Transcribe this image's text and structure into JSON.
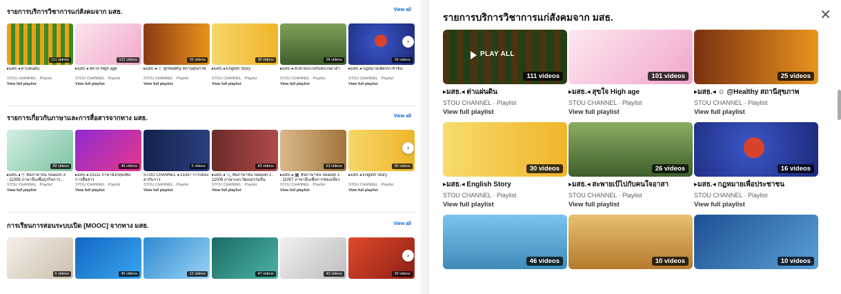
{
  "left": {
    "shelves": [
      {
        "title": "รายการบริการวิชาการแก่สังคมจาก มสธ.",
        "view_all": "View all",
        "cards": [
          {
            "title": "▸มสธ.◂ ต่าแผ่นดิน",
            "badge": "111 videos",
            "meta": "STOU CHANNEL · Playlist",
            "link": "View full playlist",
            "thumb": "#5a8c2a"
          },
          {
            "title": "▸มสธ.◂ สุขใจ High age",
            "badge": "101 videos",
            "meta": "STOU CHANNEL · Playlist",
            "link": "View full playlist",
            "thumb": "#f2b3d3"
          },
          {
            "title": "▸มสธ.◂ ☺ @Healthy สถานีสุขภาพ",
            "badge": "25 videos",
            "meta": "STOU CHANNEL · Playlist",
            "link": "View full playlist",
            "thumb": "#e58b1e"
          },
          {
            "title": "▸มสธ.◂ English Story",
            "badge": "30 videos",
            "meta": "STOU CHANNEL · Playlist",
            "link": "View full playlist",
            "thumb": "#f1c63a"
          },
          {
            "title": "▸มสธ.◂ สะพายเป้ไปกับคนใจอาสา",
            "badge": "26 videos",
            "meta": "STOU CHANNEL · Playlist",
            "link": "View full playlist",
            "thumb": "#6a8d4c"
          },
          {
            "title": "▸มสธ.◂ กฎหมายเพื่อประชาชน",
            "badge": "16 videos",
            "meta": "STOU CHANNEL · Playlist",
            "link": "View full playlist",
            "thumb": "#2b3e9b"
          }
        ]
      },
      {
        "title": "รายการเกี่ยวกับภาษาและการสื่อสารจากทาง มสธ.",
        "view_all": "View all",
        "cards": [
          {
            "title": "▸มสธ.◂ ⓔ สื่อภาษาจีน Season 3\n: 11008 ภาษาจีนเพื่อธุรกิจการ...",
            "badge": "80 videos",
            "meta": "STOU CHANNEL · Playlist",
            "link": "View full playlist",
            "thumb": "#7cc3a3"
          },
          {
            "title": "▸มสธ.◂ 10111 ภาษาอังกฤษเพื่อ\nการสื่อสาร",
            "badge": "46 videos",
            "meta": "STOU CHANNEL · Playlist",
            "link": "View full playlist",
            "thumb": "#e8388d"
          },
          {
            "title": "STOU CHANNEL ◂ 15337 การเมืองสากับการ\nพัฒนา",
            "badge": "5 videos",
            "meta": "STOU CHANNEL · Playlist",
            "link": "View full playlist",
            "thumb": "#1b2b5e"
          },
          {
            "title": "▸มสธ.◂ 🔍 สื่อภาษาจีน Season 2 :\n11009 ภาษาและวัฒนธรรมจีน",
            "badge": "83 videos",
            "meta": "STOU CHANNEL · Playlist",
            "link": "View full playlist",
            "thumb": "#b04a4a"
          },
          {
            "title": "▸มสธ.◂ 🏛 สื่อภาษาจีน Season 1\n: 11007 ภาษาจีนเพื่อการท่องเที่ยว",
            "badge": "63 videos",
            "meta": "STOU CHANNEL · Playlist",
            "link": "View full playlist",
            "thumb": "#c49a5a"
          },
          {
            "title": "▸มสธ.◂ English Story",
            "badge": "30 videos",
            "meta": "STOU CHANNEL · Playlist",
            "link": "View full playlist",
            "thumb": "#f1c63a"
          }
        ]
      },
      {
        "title": "การเรียนการสอนระบบเปิด [MOOC] จากทาง มสธ.",
        "view_all": "View all",
        "cards": [
          {
            "badge": "6 videos",
            "thumb": "#e9e4dc"
          },
          {
            "badge": "45 videos",
            "thumb": "#1e7fd8"
          },
          {
            "badge": "12 videos",
            "thumb": "#59b1e6"
          },
          {
            "badge": "47 videos",
            "thumb": "#2e8f86"
          },
          {
            "badge": "40 videos",
            "thumb": "#d7d7d7"
          },
          {
            "badge": "39 videos",
            "thumb": "#c0392b"
          }
        ]
      }
    ]
  },
  "modal": {
    "title": "รายการบริการวิชาการแก่สังคมจาก มสธ.",
    "play_all": "PLAY ALL",
    "cards": [
      {
        "title": "▸มสธ.◂ ต่าแผ่นดิน",
        "badge": "111 videos",
        "meta": "STOU CHANNEL · Playlist",
        "link": "View full playlist",
        "thumb": "#3e5a2a"
      },
      {
        "title": "▸มสธ.◂ สุขใจ High age",
        "badge": "101 videos",
        "meta": "STOU CHANNEL · Playlist",
        "link": "View full playlist",
        "thumb": "#f2b3d3"
      },
      {
        "title": "▸มสธ.◂ ☺ @Healthy สถานีสุขภาพ",
        "badge": "25 videos",
        "meta": "STOU CHANNEL · Playlist",
        "link": "View full playlist",
        "thumb": "#e58b1e"
      },
      {
        "title": "▸มสธ.◂ English Story",
        "badge": "30 videos",
        "meta": "STOU CHANNEL · Playlist",
        "link": "View full playlist",
        "thumb": "#f1c63a"
      },
      {
        "title": "▸มสธ.◂ สะพายเป้ไปกับคนใจอาสา",
        "badge": "26 videos",
        "meta": "STOU CHANNEL · Playlist",
        "link": "View full playlist",
        "thumb": "#6a8d4c"
      },
      {
        "title": "▸มสธ.◂ กฎหมายเพื่อประชาชน",
        "badge": "16 videos",
        "meta": "STOU CHANNEL · Playlist",
        "link": "View full playlist",
        "thumb": "#2b3e9b"
      },
      {
        "badge": "46 videos",
        "thumb": "#4aa0d6"
      },
      {
        "badge": "10 videos",
        "thumb": "#d8a64a"
      },
      {
        "badge": "10 videos",
        "thumb": "#2f6fb2"
      }
    ]
  }
}
